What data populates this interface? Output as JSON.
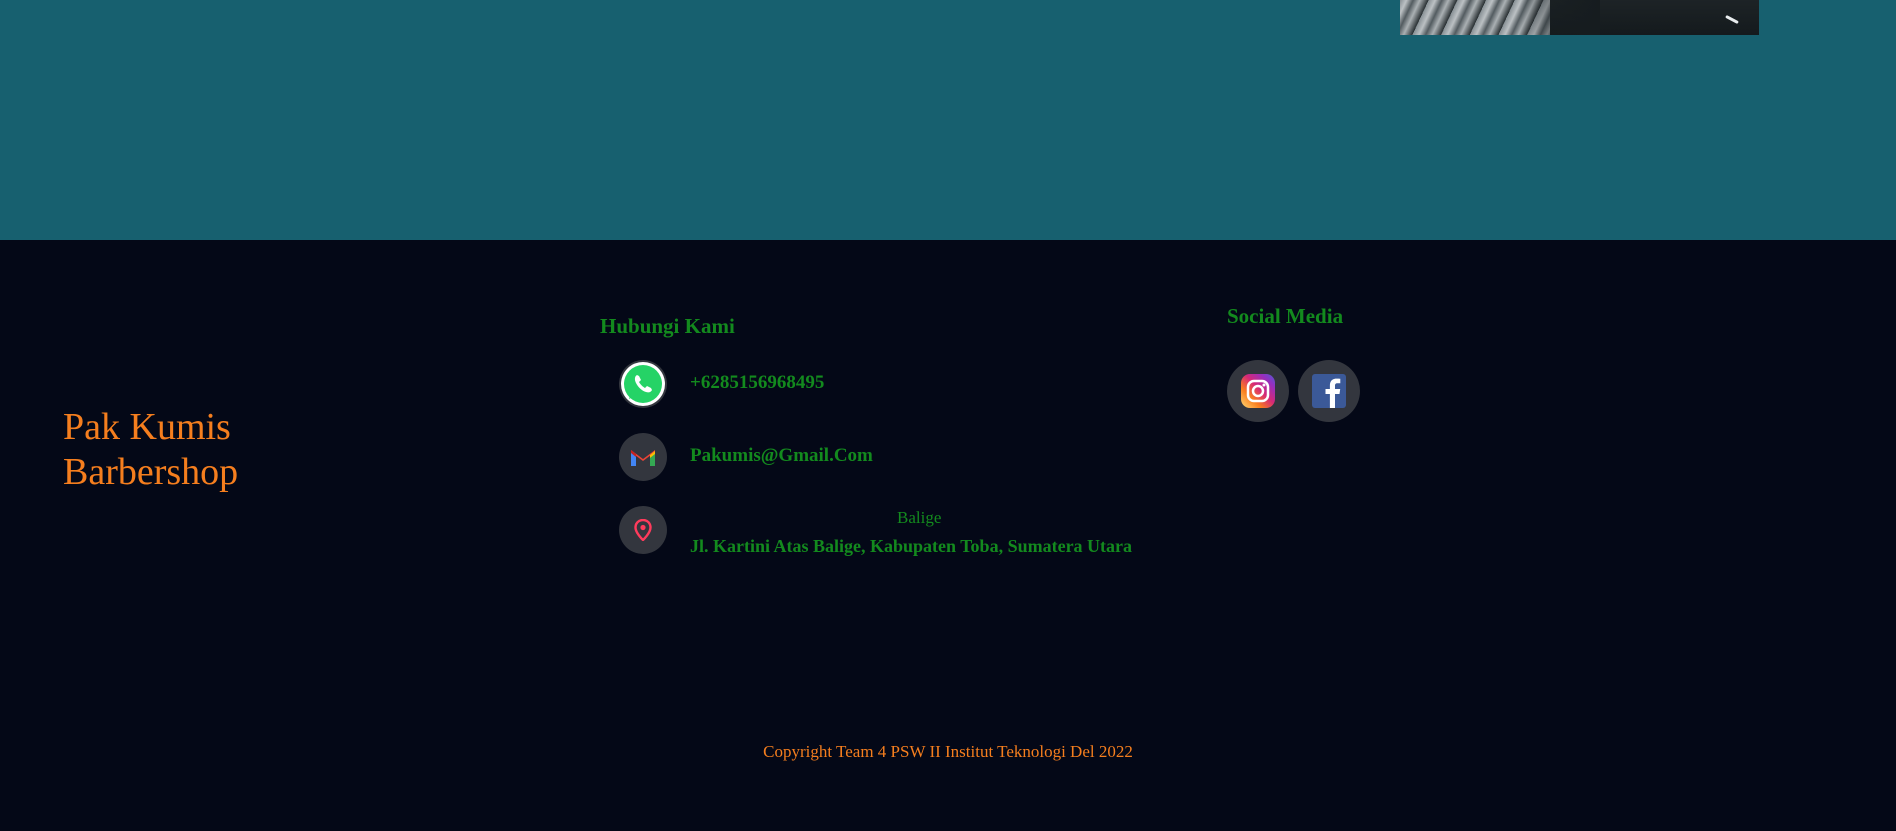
{
  "footer": {
    "brand_line1": "Pak Kumis",
    "brand_line2": "Barbershop",
    "contact_title": "Hubungi Kami",
    "phone": "+6285156968495",
    "email": "Pakumis@Gmail.Com",
    "address_city": "Balige",
    "address_line": "Jl. Kartini Atas Balige, Kabupaten Toba, Sumatera Utara",
    "social_title": "Social Media",
    "copyright": "Copyright Team 4 PSW II Institut Teknologi Del 2022"
  },
  "icons": {
    "whatsapp": "whatsapp-icon",
    "gmail": "gmail-icon",
    "location": "location-pin-icon",
    "instagram": "instagram-icon",
    "facebook": "facebook-icon"
  },
  "colors": {
    "top_band": "#17606f",
    "footer_bg": "#040817",
    "brand": "#f57e1e",
    "accent_green": "#138a1e",
    "icon_circle": "#33363e"
  }
}
